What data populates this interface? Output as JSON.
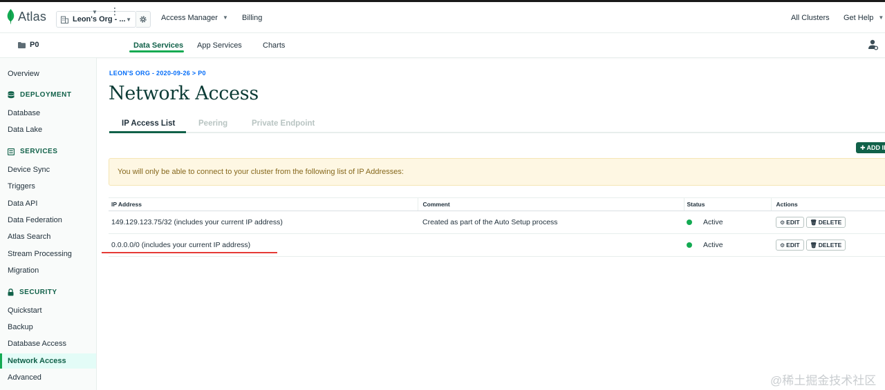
{
  "header": {
    "logo": "Atlas",
    "org": "Leon's Org - ...",
    "nav": {
      "access_manager": "Access Manager",
      "billing": "Billing",
      "all_clusters": "All Clusters",
      "get_help": "Get Help"
    }
  },
  "subheader": {
    "project": "P0",
    "tabs": {
      "data_services": "Data Services",
      "app_services": "App Services",
      "charts": "Charts"
    }
  },
  "sidebar": {
    "overview": "Overview",
    "deployment": {
      "title": "DEPLOYMENT",
      "items": [
        "Database",
        "Data Lake"
      ]
    },
    "services": {
      "title": "SERVICES",
      "items": [
        "Device Sync",
        "Triggers",
        "Data API",
        "Data Federation",
        "Atlas Search",
        "Stream Processing",
        "Migration"
      ]
    },
    "security": {
      "title": "SECURITY",
      "items": [
        "Quickstart",
        "Backup",
        "Database Access",
        "Network Access",
        "Advanced"
      ]
    }
  },
  "main": {
    "breadcrumb": "LEON'S ORG - 2020-09-26 > P0",
    "title": "Network Access",
    "tabs": [
      "IP Access List",
      "Peering",
      "Private Endpoint"
    ],
    "add_button": "ADD IP",
    "banner": "You will only be able to connect to your cluster from the following list of IP Addresses:",
    "table": {
      "headers": [
        "IP Address",
        "Comment",
        "Status",
        "Actions"
      ],
      "rows": [
        {
          "ip": "149.129.123.75/32  (includes your current IP address)",
          "comment": "Created as part of the Auto Setup process",
          "status": "Active"
        },
        {
          "ip": "0.0.0.0/0  (includes your current IP address)",
          "comment": "",
          "status": "Active"
        }
      ],
      "edit_label": "EDIT",
      "delete_label": "DELETE"
    }
  },
  "watermark": "@稀土掘金技术社区",
  "colors": {
    "brand_green": "#116149",
    "accent_green": "#13aa52",
    "link_blue": "#016bf8",
    "warning_bg": "#fef7e3",
    "annotation_red": "#e53935"
  }
}
